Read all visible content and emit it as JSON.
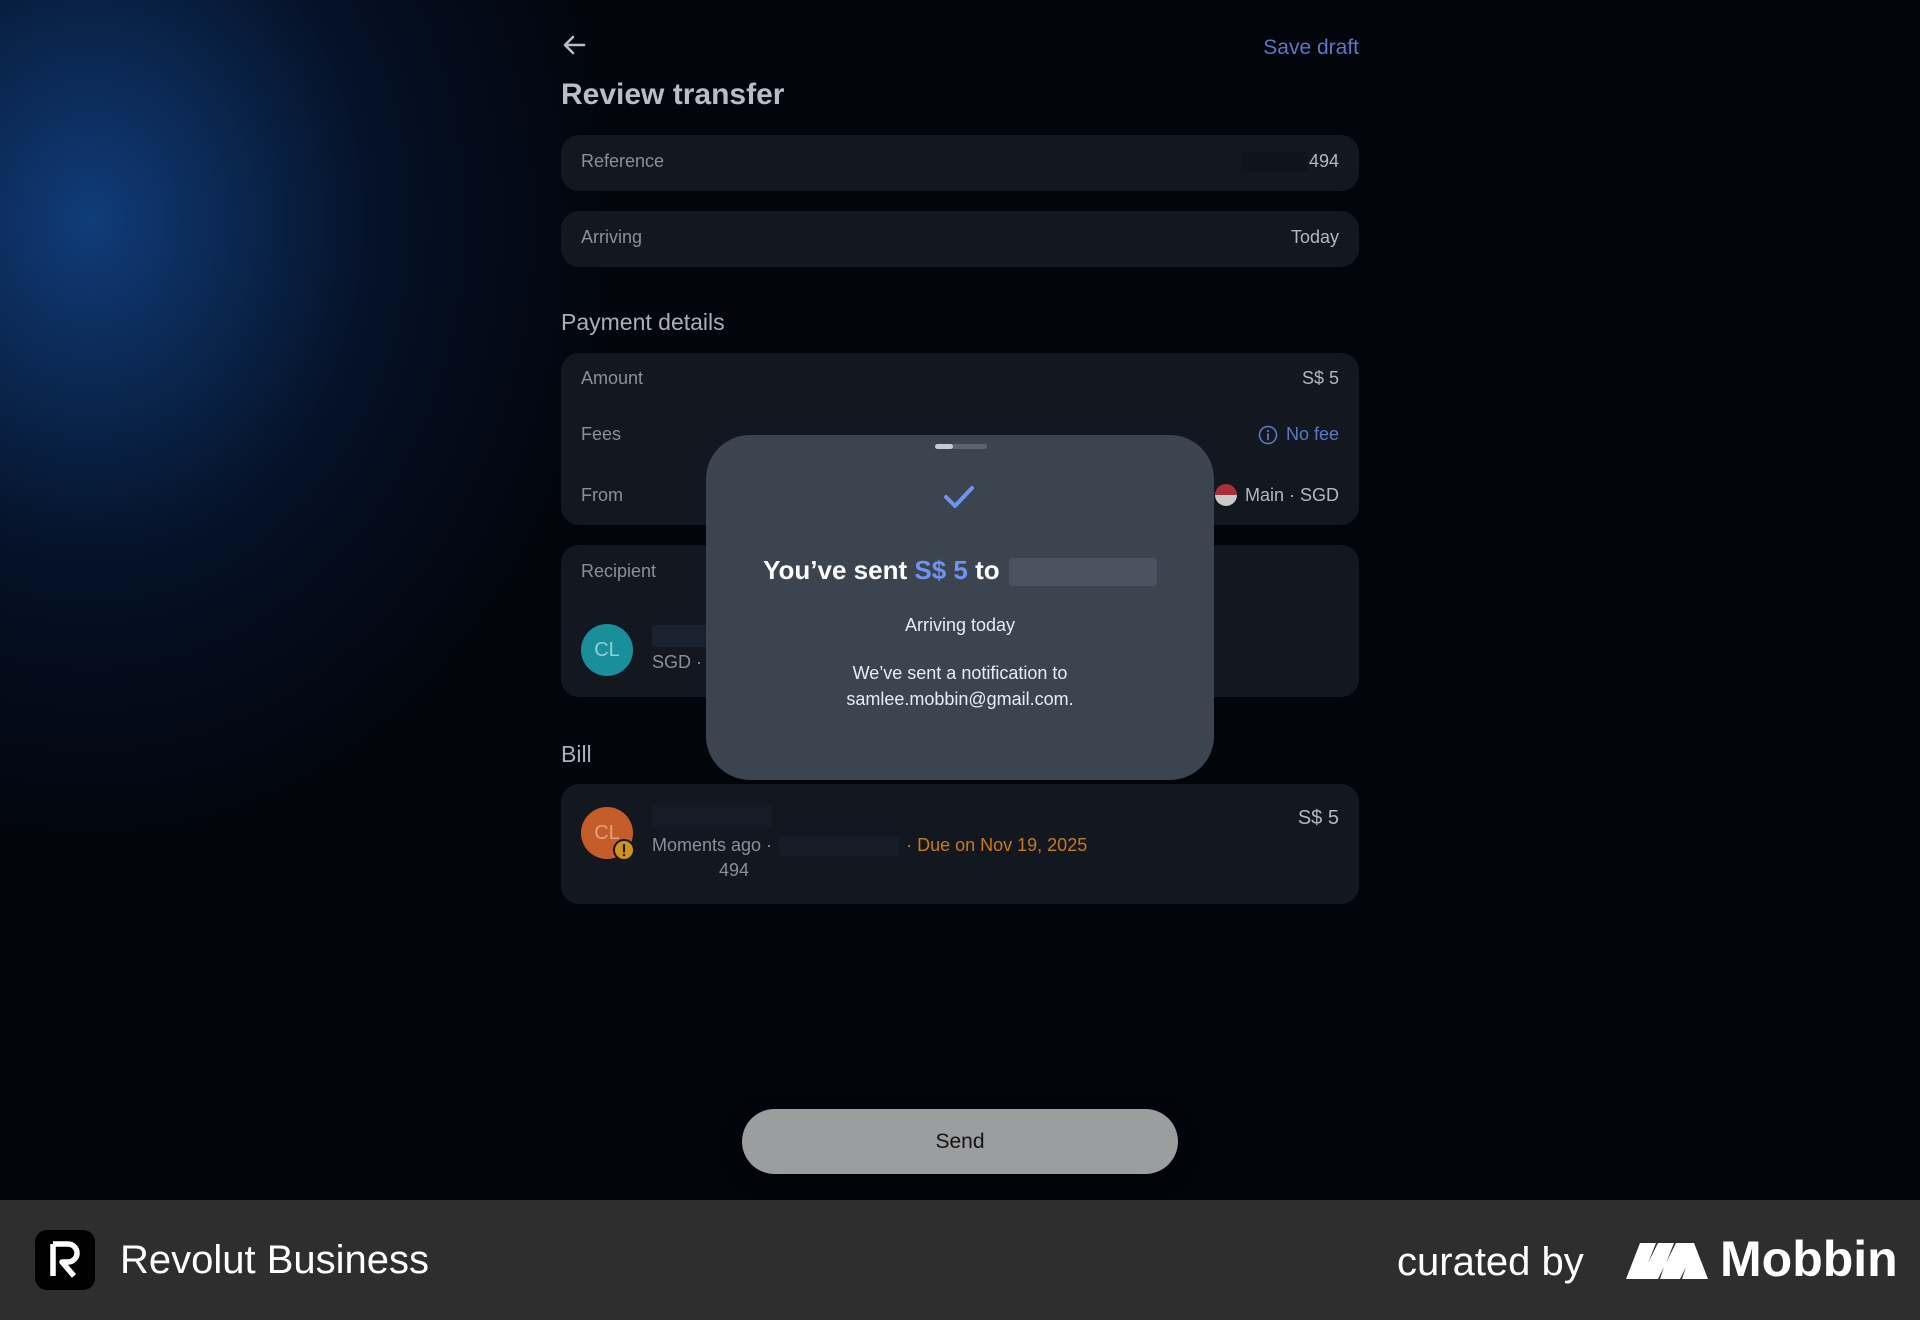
{
  "header": {
    "save_draft_label": "Save draft",
    "title": "Review transfer"
  },
  "summary": {
    "reference_label": "Reference",
    "reference_value": "494",
    "arriving_label": "Arriving",
    "arriving_value": "Today"
  },
  "payment_details": {
    "section_title": "Payment details",
    "amount_label": "Amount",
    "amount_value": "S$ 5",
    "fees_label": "Fees",
    "fees_value": "No fee",
    "from_label": "From",
    "from_value": "Main · SGD"
  },
  "recipient": {
    "label": "Recipient",
    "initials": "CL",
    "sub": "SGD ·"
  },
  "bill": {
    "section_title": "Bill",
    "initials": "CL",
    "amount": "S$ 5",
    "time": "Moments ago ·",
    "due": "· Due on Nov 19, 2025",
    "reference": "494"
  },
  "modal": {
    "title_prefix": "You’ve sent",
    "title_amount": "S$ 5",
    "title_to": "to",
    "arriving": "Arriving today",
    "note_line1": "We’ve sent a notification to",
    "note_line2": "samlee.mobbin@gmail.com."
  },
  "actions": {
    "send_label": "Send"
  },
  "footer": {
    "app_name": "Revolut Business",
    "curated_by": "curated by",
    "brand": "Mobbin"
  },
  "colors": {
    "accent": "#6f93f0",
    "link": "#5c78c2",
    "due_warning": "#c77a1e",
    "recipient_avatar": "#1a8f9c",
    "bill_avatar": "#c45d2a"
  },
  "icons": [
    "back-arrow-icon",
    "info-icon",
    "singapore-flag-icon",
    "checkmark-icon",
    "warning-icon",
    "revolut-logo-icon",
    "mobbin-logo-icon"
  ]
}
